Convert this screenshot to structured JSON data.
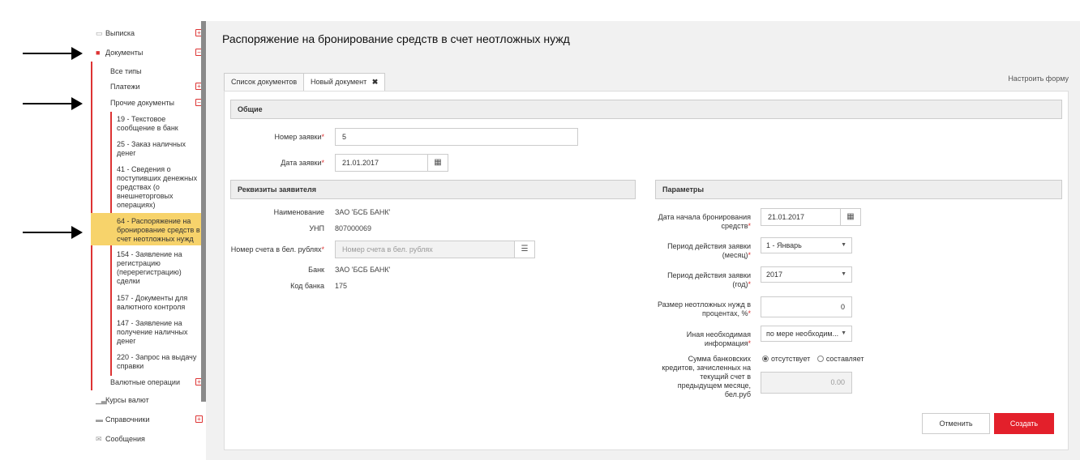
{
  "sidebar": {
    "extract": "Выписка",
    "documents": "Документы",
    "all_types": "Все типы",
    "payments": "Платежи",
    "other_docs": "Прочие документы",
    "doc_items": [
      "19 - Текстовое сообщение в банк",
      "25 - Заказ наличных денег",
      "41 - Сведения о поступивших денежных средствах (о внешнеторговых операциях)",
      "64 - Распоряжение на бронирование средств в счет неотложных нужд",
      "154 - Заявление на регистрацию (перерегистрацию) сделки",
      "157 - Документы для валютного контроля",
      "147 - Заявление на получение наличных денег",
      "220 - Запрос на выдачу справки"
    ],
    "currency_ops": "Валютные операции",
    "rates": "Курсы валют",
    "refs": "Справочники",
    "messages": "Сообщения"
  },
  "page": {
    "title": "Распоряжение на бронирование средств в счет неотложных нужд",
    "configure": "Настроить форму",
    "tabs": [
      "Список документов",
      "Новый документ"
    ]
  },
  "general": {
    "section": "Общие",
    "num_label": "Номер заявки",
    "num_value": "5",
    "date_label": "Дата заявки",
    "date_value": "21.01.2017"
  },
  "applicant": {
    "section": "Реквизиты заявителя",
    "name_label": "Наименование",
    "name_value": "ЗАО 'БСБ БАНК'",
    "unp_label": "УНП",
    "unp_value": "807000069",
    "account_label": "Номер счета в бел. рублях",
    "account_placeholder": "Номер счета в бел. рублях",
    "bank_label": "Банк",
    "bank_value": "ЗАО 'БСБ БАНК'",
    "bank_code_label": "Код банка",
    "bank_code_value": "175"
  },
  "params": {
    "section": "Параметры",
    "start_label": "Дата начала бронирования средств",
    "start_value": "21.01.2017",
    "month_label": "Период действия заявки (месяц)",
    "month_value": "1 - Январь",
    "year_label": "Период действия заявки (год)",
    "year_value": "2017",
    "percent_label": "Размер неотложных нужд в процентах, %",
    "percent_value": "0",
    "info_label": "Иная необходимая информация",
    "info_value": "по мере необходим...",
    "credits_label": "Сумма банковских кредитов, зачисленных на текущий счет в предыдущем месяце, бел.руб",
    "radio_absent": "отсутствует",
    "radio_present": "составляет",
    "credits_value": "0.00"
  },
  "actions": {
    "cancel": "Отменить",
    "create": "Создать"
  },
  "colors": {
    "accent": "#e3202b",
    "highlight": "#f7d36b"
  }
}
